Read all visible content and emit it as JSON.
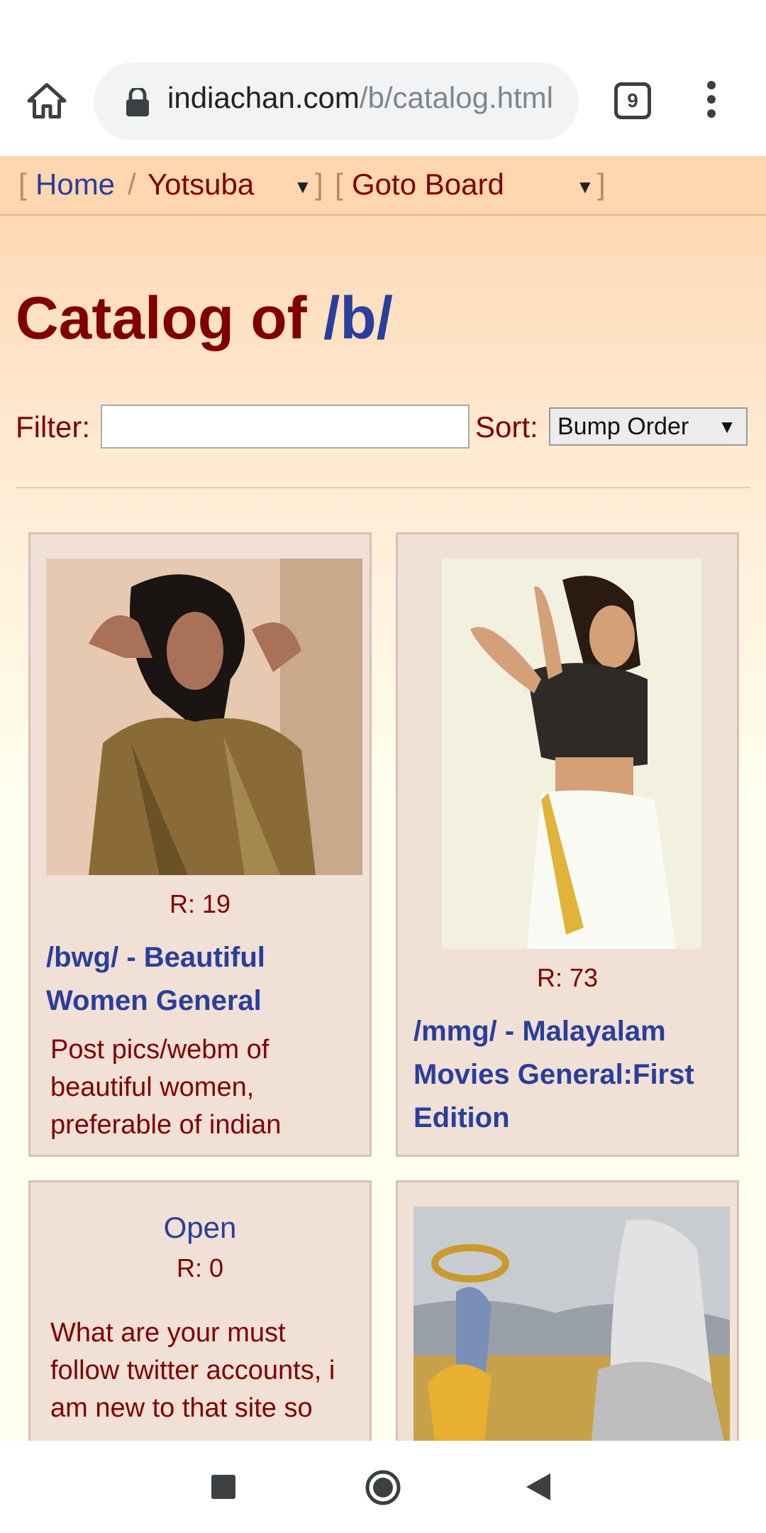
{
  "browser": {
    "url_host": "indiachan.com",
    "url_path": "/b/catalog.html",
    "tab_count": "9"
  },
  "boardlist": {
    "open_bracket": "[",
    "home": "Home",
    "separator": "/",
    "style": "Yotsuba",
    "close_bracket": "]",
    "goto": "Goto Board"
  },
  "title": {
    "prefix": "Catalog of",
    "board": "/b/"
  },
  "filter": {
    "label": "Filter:",
    "value": "",
    "sort_label": "Sort:",
    "sort_value": "Bump Order"
  },
  "threads": [
    {
      "replies": "R: 19",
      "subject": "/bwg/ - Beautiful Women General",
      "body": "Post pics/webm of beautiful women, preferable of indian"
    },
    {
      "replies": "R: 73",
      "subject": "/mmg/ - Malayalam Movies General:First Edition",
      "body": ""
    },
    {
      "open": "Open",
      "replies": "R: 0",
      "body": "What are your must follow twitter accounts, i am new to that site so"
    },
    {
      "replies": "",
      "subject": "",
      "body": ""
    }
  ],
  "colors": {
    "board_bg": "#fed6af",
    "card_bg": "#f0e0d6",
    "link": "#2a3e9b",
    "text": "#800000"
  }
}
